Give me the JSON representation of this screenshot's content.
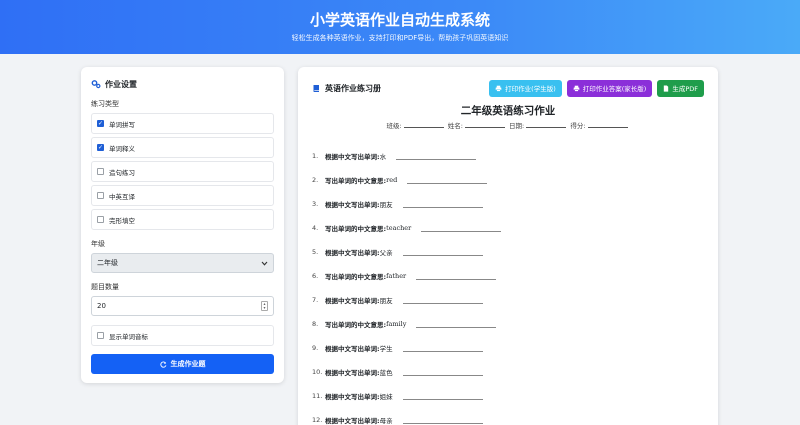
{
  "header": {
    "title": "小学英语作业自动生成系统",
    "subtitle": "轻松生成各种英语作业，支持打印和PDF导出，帮助孩子巩固英语知识"
  },
  "settings": {
    "title": "作业设置",
    "type_label": "练习类型",
    "types": [
      {
        "label": "单词拼写",
        "checked": true
      },
      {
        "label": "单词释义",
        "checked": true
      },
      {
        "label": "造句练习",
        "checked": false
      },
      {
        "label": "中英互译",
        "checked": false
      },
      {
        "label": "完形填空",
        "checked": false
      }
    ],
    "grade_label": "年级",
    "grade_value": "二年级",
    "count_label": "题目数量",
    "count_value": "20",
    "phonetic_label": "显示单词音标",
    "generate_label": "生成作业题"
  },
  "worksheet_panel": {
    "title": "英语作业练习册",
    "print_student": "打印作业(学生版)",
    "print_answer": "打印作业答案(家长版)",
    "pdf": "生成PDF"
  },
  "worksheet": {
    "title": "二年级英语练习作业",
    "class_label": "班级:",
    "name_label": "姓名:",
    "date_label": "日期:",
    "score_label": "得分:",
    "questions": [
      {
        "num": "1.",
        "prompt": "根据中文写出单词:",
        "word": "水"
      },
      {
        "num": "2.",
        "prompt": "写出单词的中文意思:",
        "word": "red"
      },
      {
        "num": "3.",
        "prompt": "根据中文写出单词:",
        "word": "朋友"
      },
      {
        "num": "4.",
        "prompt": "写出单词的中文意思:",
        "word": "teacher"
      },
      {
        "num": "5.",
        "prompt": "根据中文写出单词:",
        "word": "父亲"
      },
      {
        "num": "6.",
        "prompt": "写出单词的中文意思:",
        "word": "father"
      },
      {
        "num": "7.",
        "prompt": "根据中文写出单词:",
        "word": "朋友"
      },
      {
        "num": "8.",
        "prompt": "写出单词的中文意思:",
        "word": "family"
      },
      {
        "num": "9.",
        "prompt": "根据中文写出单词:",
        "word": "学生"
      },
      {
        "num": "10.",
        "prompt": "根据中文写出单词:",
        "word": "蓝色"
      },
      {
        "num": "11.",
        "prompt": "根据中文写出单词:",
        "word": "姐妹"
      },
      {
        "num": "12.",
        "prompt": "根据中文写出单词:",
        "word": "母亲"
      }
    ]
  },
  "colors": {
    "primary": "#1461f5",
    "cyan": "#39c0f0",
    "purple": "#8b2fd9",
    "green": "#1f9d4b"
  }
}
